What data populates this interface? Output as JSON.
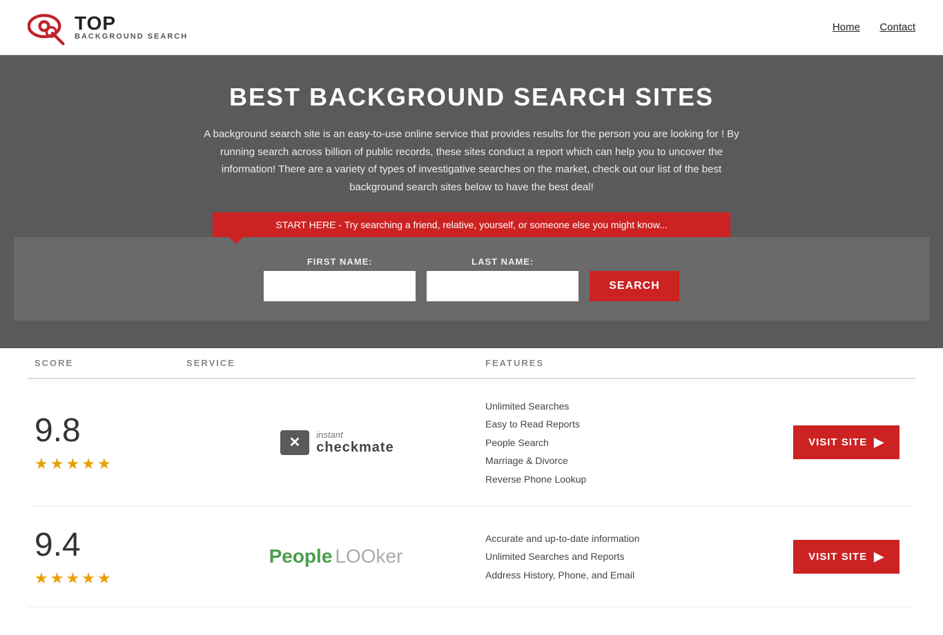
{
  "header": {
    "logo_top": "TOP",
    "logo_sub": "BACKGROUND SEARCH",
    "nav": {
      "home": "Home",
      "contact": "Contact"
    }
  },
  "hero": {
    "title": "BEST BACKGROUND SEARCH SITES",
    "description": "A background search site is an easy-to-use online service that provides results  for the person you are looking for ! By  running  search across billion of public records, these sites conduct  a report which can help you to uncover the information! There are a variety of types of investigative searches on the market, check out our  list of the best background search sites below to have the best deal!",
    "search_banner": "START HERE - Try searching a friend, relative, yourself, or someone else you might know...",
    "first_name_label": "FIRST NAME:",
    "last_name_label": "LAST NAME:",
    "search_button": "SEARCH"
  },
  "table": {
    "headers": {
      "score": "SCORE",
      "service": "SERVICE",
      "features": "FEATURES",
      "action": ""
    },
    "rows": [
      {
        "score": "9.8",
        "stars": 4.5,
        "service_name": "Instant Checkmate",
        "features": [
          "Unlimited Searches",
          "Easy to Read Reports",
          "People Search",
          "Marriage & Divorce",
          "Reverse Phone Lookup"
        ],
        "visit_button": "VISIT SITE"
      },
      {
        "score": "9.4",
        "stars": 4.5,
        "service_name": "PeopleLooker",
        "features": [
          "Accurate and up-to-date information",
          "Unlimited Searches and Reports",
          "Address History, Phone, and Email"
        ],
        "visit_button": "VISIT SITE"
      }
    ]
  }
}
